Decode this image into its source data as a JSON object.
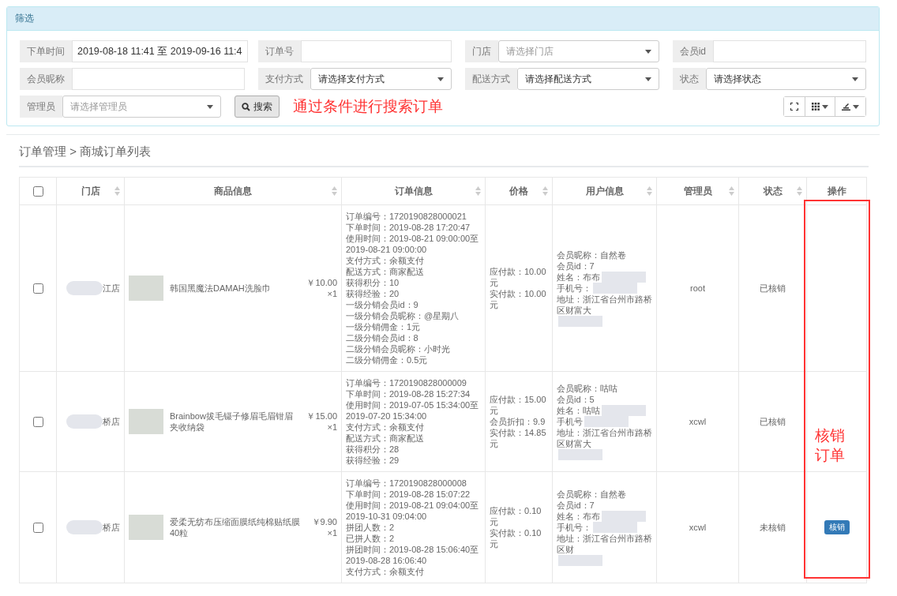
{
  "filter_panel": {
    "title": "筛选",
    "fields": [
      {
        "label": "下单时间",
        "kind": "text",
        "value": "2019-08-18 11:41 至 2019-09-16 11:4"
      },
      {
        "label": "订单号",
        "kind": "text"
      },
      {
        "label": "门店",
        "kind": "select",
        "placeholder": "请选择门店"
      },
      {
        "label": "会员id",
        "kind": "text"
      },
      {
        "label": "会员昵称",
        "kind": "text"
      },
      {
        "label": "支付方式",
        "kind": "select",
        "value": "请选择支付方式"
      },
      {
        "label": "配送方式",
        "kind": "select",
        "value": "请选择配送方式"
      },
      {
        "label": "状态",
        "kind": "select",
        "value": "请选择状态"
      },
      {
        "label": "管理员",
        "kind": "select",
        "placeholder": "请选择管理员"
      }
    ],
    "search_button": "搜索",
    "annotation": "通过条件进行搜索订单"
  },
  "breadcrumb": "订单管理 > 商城订单列表",
  "table": {
    "select_all_checked": false,
    "columns": [
      {
        "kind": "checkbox",
        "sortable": false
      },
      {
        "label": "门店",
        "sortable": true
      },
      {
        "label": "商品信息",
        "sortable": true
      },
      {
        "label": "订单信息",
        "sortable": true
      },
      {
        "label": "价格",
        "sortable": true
      },
      {
        "label": "用户信息",
        "sortable": true
      },
      {
        "label": "管理员",
        "sortable": true
      },
      {
        "label": "状态",
        "sortable": true
      },
      {
        "label": "操作",
        "sortable": false
      }
    ],
    "rows": [
      {
        "checked": false,
        "store": {
          "text": "江店",
          "redacted": true
        },
        "product": {
          "name": "韩国黑魔法DAMAH洗脸巾",
          "price": "￥10.00",
          "qty": "×1"
        },
        "order_info": [
          "订单编号：1720190828000021",
          "下单时间：2019-08-28 17:20:47",
          "使用时间：2019-08-21 09:00:00至2019-08-21 09:00:00",
          "支付方式：余额支付",
          "配送方式：商家配送",
          "获得积分：10",
          "获得经验：20",
          "一级分销会员id：9",
          "一级分销会员昵称：@星期八",
          "一级分销佣金：1元",
          "二级分销会员id：8",
          "二级分销会员昵称：小时光",
          "二级分销佣金：0.5元"
        ],
        "price": [
          "应付款：10.00元",
          "实付款：10.00元"
        ],
        "user": [
          {
            "text": "会员昵称：自然卷",
            "redacted": false
          },
          {
            "text": "会员id：7",
            "redacted": false
          },
          {
            "text": "姓名：布布",
            "redacted": true
          },
          {
            "text": "手机号：",
            "redacted": true
          },
          {
            "text": "地址：浙江省台州市路桥区财富大",
            "redacted": true
          }
        ],
        "admin": "root",
        "status": "已核销"
      },
      {
        "checked": false,
        "store": {
          "text": "桥店",
          "redacted": true
        },
        "product": {
          "name": "Brainbow拔毛镊子修眉毛眉钳眉夹收纳袋",
          "price": "￥15.00",
          "qty": "×1"
        },
        "order_info": [
          "订单编号：1720190828000009",
          "下单时间：2019-08-28 15:27:34",
          "使用时间：2019-07-05 15:34:00至2019-07-20 15:34:00",
          "支付方式：余额支付",
          "配送方式：商家配送",
          "获得积分：28",
          "获得经验：29"
        ],
        "price": [
          "应付款：15.00元",
          "会员折扣：9.9",
          "实付款：14.85元"
        ],
        "user": [
          {
            "text": "会员昵称：咕咕",
            "redacted": false
          },
          {
            "text": "会员id：5",
            "redacted": false
          },
          {
            "text": "姓名：咕咕",
            "redacted": true
          },
          {
            "text": "手机号",
            "redacted": true
          },
          {
            "text": "地址：浙江省台州市路桥区财富大",
            "redacted": true
          }
        ],
        "admin": "xcwl",
        "status": "已核销"
      },
      {
        "checked": false,
        "store": {
          "text": "桥店",
          "redacted": true
        },
        "product": {
          "name": "爱柔无纺布压缩面膜纸纯棉贴纸膜 40粒",
          "price": "￥9.90",
          "qty": "×1"
        },
        "order_info": [
          "订单编号：1720190828000008",
          "下单时间：2019-08-28 15:07:22",
          "使用时间：2019-08-21 09:04:00至2019-10-31 09:04:00",
          "拼团人数：2",
          "已拼人数：2",
          "拼团时间：2019-08-28 15:06:40至2019-08-28 16:06:40",
          "支付方式：余额支付"
        ],
        "price": [
          "应付款：0.10元",
          "实付款：0.10元"
        ],
        "user": [
          {
            "text": "会员昵称：自然卷",
            "redacted": false
          },
          {
            "text": "会员id：7",
            "redacted": false
          },
          {
            "text": "姓名：布布",
            "redacted": true
          },
          {
            "text": "手机号：",
            "redacted": true
          },
          {
            "text": "地址：浙江省台州市路桥区财",
            "redacted": true
          }
        ],
        "admin": "xcwl",
        "status": "未核销",
        "action": "核销"
      }
    ]
  },
  "action_annotation": "核销订单"
}
